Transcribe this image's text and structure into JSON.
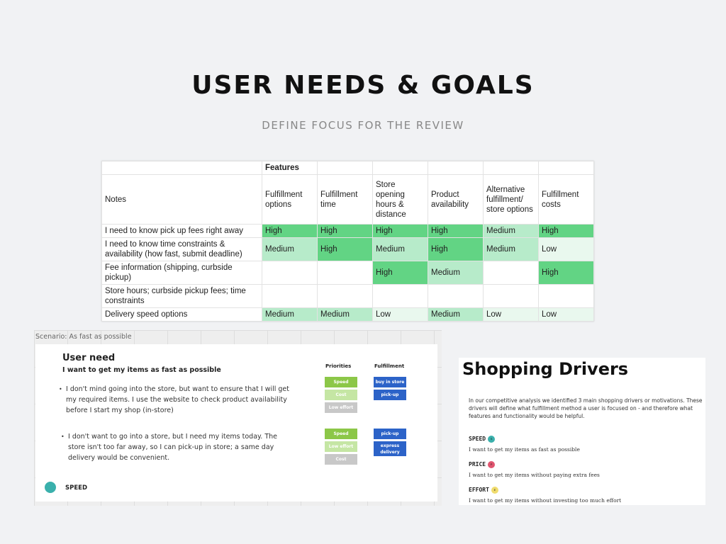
{
  "header": {
    "title": "USER NEEDS & GOALS",
    "subtitle": "DEFINE FOCUS FOR THE REVIEW"
  },
  "table": {
    "group_header": "Features",
    "notes_header": "Notes",
    "columns": [
      "Fulfillment options",
      "Fulfillment time",
      "Store opening hours & distance",
      "Product availability",
      "Alternative fulfillment/ store options",
      "Fulfillment costs"
    ],
    "rows": [
      {
        "note": "I need to know pick up fees right away",
        "values": [
          "High",
          "High",
          "High",
          "High",
          "Medium",
          "High"
        ]
      },
      {
        "note": "I need to know time constraints & availability (how fast, submit deadline)",
        "values": [
          "Medium",
          "High",
          "Medium",
          "High",
          "Medium",
          "Low"
        ]
      },
      {
        "note": "Fee information (shipping, curbside pickup)",
        "values": [
          "",
          "",
          "High",
          "Medium",
          "",
          "High"
        ]
      },
      {
        "note": "Store hours; curbside pickup fees; time constraints",
        "values": [
          "",
          "",
          "",
          "",
          "",
          ""
        ]
      },
      {
        "note": "Delivery speed options",
        "values": [
          "Medium",
          "Medium",
          "Low",
          "Medium",
          "Low",
          "Low"
        ]
      }
    ]
  },
  "scenario": {
    "label": "Scenario: As fast as possible",
    "title": "User need",
    "subtitle": "I want to get my items as fast as possible",
    "priorities_header": "Priorities",
    "fulfillment_header": "Fulfillment",
    "items": [
      {
        "text": "I don't mind going into the store, but want to ensure that I will get my required items. I use the website to check product availability before I start my shop (in-store)",
        "priorities": [
          "Speed",
          "Cost",
          "Low effort"
        ],
        "fulfillment": [
          "buy in store",
          "pick-up"
        ]
      },
      {
        "text": "I don't want to go into a store, but I need my items today. The store isn't too far away, so I can pick-up in store; a same day delivery would be convenient.",
        "priorities": [
          "Speed",
          "Low effort",
          "Cost"
        ],
        "fulfillment": [
          "pick-up",
          "express delivery"
        ]
      }
    ],
    "footer_label": "SPEED",
    "footer_color": "#3ab0ac"
  },
  "drivers": {
    "title": "Shopping Drivers",
    "intro": "In our competitive analysis we identified 3 main shopping drivers or motivations. These drivers will define what fulfillment method a user is focused on - and therefore what features and functionality would be helpful.",
    "items": [
      {
        "name": "SPEED",
        "badge": "S",
        "color": "#3ab0ac",
        "desc": "I want to get my items as fast as possible"
      },
      {
        "name": "PRICE",
        "badge": "P",
        "color": "#e0556f",
        "desc": "I want to get my items without paying extra fees"
      },
      {
        "name": "EFFORT",
        "badge": "E",
        "color": "#f0dc6e",
        "desc": "I want to get my items without investing too much effort"
      }
    ]
  }
}
